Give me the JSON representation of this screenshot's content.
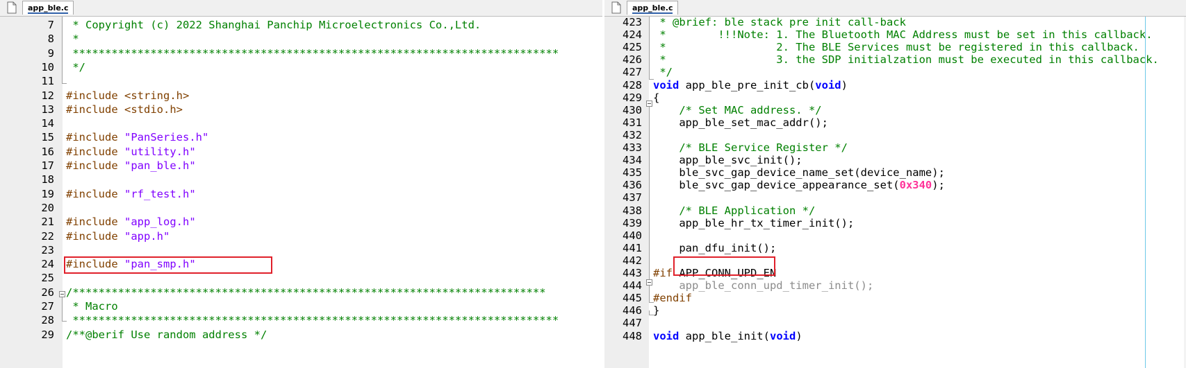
{
  "left": {
    "tab": "app_ble.c",
    "lines": [
      {
        "n": "7",
        "segs": [
          {
            "t": " * Copyright (c) 2022 Shanghai Panchip Microelectronics Co.,Ltd.",
            "c": "comment"
          }
        ]
      },
      {
        "n": "8",
        "segs": [
          {
            "t": " *",
            "c": "comment"
          }
        ]
      },
      {
        "n": "9",
        "segs": [
          {
            "t": " ***************************************************************************",
            "c": "comment"
          }
        ]
      },
      {
        "n": "10",
        "segs": [
          {
            "t": " */",
            "c": "comment"
          }
        ]
      },
      {
        "n": "11",
        "segs": []
      },
      {
        "n": "12",
        "segs": [
          {
            "t": "#include ",
            "c": "pre"
          },
          {
            "t": "<string.h>",
            "c": "pre"
          }
        ]
      },
      {
        "n": "13",
        "segs": [
          {
            "t": "#include ",
            "c": "pre"
          },
          {
            "t": "<stdio.h>",
            "c": "pre"
          }
        ]
      },
      {
        "n": "14",
        "segs": []
      },
      {
        "n": "15",
        "segs": [
          {
            "t": "#include ",
            "c": "pre"
          },
          {
            "t": "\"PanSeries.h\"",
            "c": "str"
          }
        ]
      },
      {
        "n": "16",
        "segs": [
          {
            "t": "#include ",
            "c": "pre"
          },
          {
            "t": "\"utility.h\"",
            "c": "str"
          }
        ]
      },
      {
        "n": "17",
        "segs": [
          {
            "t": "#include ",
            "c": "pre"
          },
          {
            "t": "\"pan_ble.h\"",
            "c": "str"
          }
        ]
      },
      {
        "n": "18",
        "segs": []
      },
      {
        "n": "19",
        "segs": [
          {
            "t": "#include ",
            "c": "pre"
          },
          {
            "t": "\"rf_test.h\"",
            "c": "str"
          }
        ]
      },
      {
        "n": "20",
        "segs": []
      },
      {
        "n": "21",
        "segs": [
          {
            "t": "#include ",
            "c": "pre"
          },
          {
            "t": "\"app_log.h\"",
            "c": "str"
          }
        ]
      },
      {
        "n": "22",
        "segs": [
          {
            "t": "#include ",
            "c": "pre"
          },
          {
            "t": "\"app.h\"",
            "c": "str"
          }
        ]
      },
      {
        "n": "23",
        "segs": []
      },
      {
        "n": "24",
        "segs": [
          {
            "t": "#include ",
            "c": "pre"
          },
          {
            "t": "\"pan_smp.h\"",
            "c": "str"
          }
        ]
      },
      {
        "n": "25",
        "segs": []
      },
      {
        "n": "26",
        "segs": [
          {
            "t": "/*************************************************************************",
            "c": "comment"
          }
        ]
      },
      {
        "n": "27",
        "segs": [
          {
            "t": " * Macro",
            "c": "comment"
          }
        ]
      },
      {
        "n": "28",
        "segs": [
          {
            "t": " ***************************************************************************",
            "c": "comment"
          }
        ]
      },
      {
        "n": "29",
        "segs": [
          {
            "t": "/**@berif Use random address */",
            "c": "comment"
          }
        ]
      }
    ]
  },
  "right": {
    "tab": "app_ble.c",
    "lines": [
      {
        "n": "423",
        "segs": [
          {
            "t": " * @brief: ble stack pre init call-back",
            "c": "comment"
          }
        ]
      },
      {
        "n": "424",
        "segs": [
          {
            "t": " *        !!!Note: 1. The Bluetooth MAC Address must be set in this callback.",
            "c": "comment"
          }
        ]
      },
      {
        "n": "425",
        "segs": [
          {
            "t": " *                 2. The BLE Services must be registered in this callback.",
            "c": "comment"
          }
        ]
      },
      {
        "n": "426",
        "segs": [
          {
            "t": " *                 3. the SDP initialzation must be executed in this callback.",
            "c": "comment"
          }
        ]
      },
      {
        "n": "427",
        "segs": [
          {
            "t": " */",
            "c": "comment"
          }
        ]
      },
      {
        "n": "428",
        "segs": [
          {
            "t": "void",
            "c": "kw"
          },
          {
            "t": " app_ble_pre_init_cb(",
            "c": "def"
          },
          {
            "t": "void",
            "c": "kw"
          },
          {
            "t": ")",
            "c": "def"
          }
        ]
      },
      {
        "n": "429",
        "segs": [
          {
            "t": "{",
            "c": "def"
          }
        ]
      },
      {
        "n": "430",
        "segs": [
          {
            "t": "    ",
            "c": "def"
          },
          {
            "t": "/* Set MAC address. */",
            "c": "comment"
          }
        ]
      },
      {
        "n": "431",
        "segs": [
          {
            "t": "    app_ble_set_mac_addr();",
            "c": "def"
          }
        ]
      },
      {
        "n": "432",
        "segs": []
      },
      {
        "n": "433",
        "segs": [
          {
            "t": "    ",
            "c": "def"
          },
          {
            "t": "/* BLE Service Register */",
            "c": "comment"
          }
        ]
      },
      {
        "n": "434",
        "segs": [
          {
            "t": "    app_ble_svc_init();",
            "c": "def"
          }
        ]
      },
      {
        "n": "435",
        "segs": [
          {
            "t": "    ble_svc_gap_device_name_set(device_name);",
            "c": "def"
          }
        ]
      },
      {
        "n": "436",
        "segs": [
          {
            "t": "    ble_svc_gap_device_appearance_set(",
            "c": "def"
          },
          {
            "t": "0x340",
            "c": "num"
          },
          {
            "t": ");",
            "c": "def"
          }
        ]
      },
      {
        "n": "437",
        "segs": []
      },
      {
        "n": "438",
        "segs": [
          {
            "t": "    ",
            "c": "def"
          },
          {
            "t": "/* BLE Application */",
            "c": "comment"
          }
        ]
      },
      {
        "n": "439",
        "segs": [
          {
            "t": "    app_ble_hr_tx_timer_init();",
            "c": "def"
          }
        ]
      },
      {
        "n": "440",
        "segs": []
      },
      {
        "n": "441",
        "segs": [
          {
            "t": "    pan_dfu_init();",
            "c": "def"
          }
        ]
      },
      {
        "n": "442",
        "segs": []
      },
      {
        "n": "443",
        "segs": [
          {
            "t": "#if",
            "c": "pre"
          },
          {
            "t": " APP_CONN_UPD_EN",
            "c": "def"
          }
        ]
      },
      {
        "n": "444",
        "segs": [
          {
            "t": "    app_ble_conn_upd_timer_init();",
            "c": "dim"
          }
        ]
      },
      {
        "n": "445",
        "segs": [
          {
            "t": "#endif",
            "c": "pre"
          }
        ]
      },
      {
        "n": "446",
        "segs": [
          {
            "t": "}",
            "c": "def"
          }
        ]
      },
      {
        "n": "447",
        "segs": []
      },
      {
        "n": "448",
        "segs": [
          {
            "t": "void",
            "c": "kw"
          },
          {
            "t": " app_ble_init(",
            "c": "def"
          },
          {
            "t": "void",
            "c": "kw"
          },
          {
            "t": ")",
            "c": "def"
          }
        ]
      }
    ]
  },
  "colors": {
    "comment": "#008000",
    "preprocessor": "#804000",
    "string": "#8000ff",
    "keyword": "#0000ff",
    "number": "#ff3399",
    "highlight_box": "#e0202a"
  },
  "icons": [
    "file-icon",
    "fold-toggle-icon"
  ]
}
